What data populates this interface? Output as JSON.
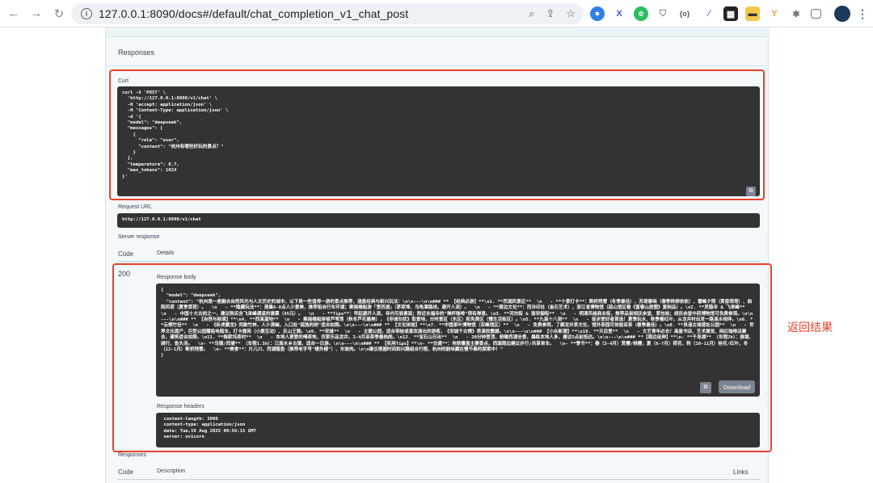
{
  "browser": {
    "url": "127.0.0.1:8090/docs#/default/chat_completion_v1_chat_post"
  },
  "responses_title": "Responses",
  "curl": {
    "label": "Curl",
    "code": "curl -X 'POST' \\\n  'http://127.0.0.1:8090/v1/chat' \\\n  -H 'accept: application/json' \\\n  -H 'Content-Type: application/json' \\\n  -d '{\n  \"model\": \"deepseek\",\n  \"messages\": [\n    {\n      \"role\": \"user\",\n      \"content\": \"杭州有哪些好玩的景点？\"\n    }\n  ],\n  \"temperature\": 0.7,\n  \"max_tokens\": 1024\n}'"
  },
  "request_url": {
    "label": "Request URL",
    "value": "http://127.0.0.1:8090/v1/chat"
  },
  "server_response": {
    "label": "Server response",
    "col_code": "Code",
    "col_details": "Details",
    "status_code": "200",
    "body_label": "Response body",
    "body": "{\n  \"model\": \"deepseek\",\n  \"content\": \"杭州是一座融合自然风光与人文历史的城市，以下是一些值得一游的景点推荐，涵盖经典与新兴玩法：\\n\\n---\\n\\n### ** 【经典必游】**\\n1. **西湖风景区**  \\n   - **十景打卡**：断桥残雪（冬季最佳）、苏堤春晓（春季杨柳依依）、雷峰夕照（黄昏观塔）、曲院风荷（夏季赏荷）。  \\n   - **隐藏玩法**：清晨6-8点人少景美，推荐租自行车环湖；乘摇橹船游「里西湖」（茅家埠、乌龟潭路线，避开人流）。  \\n   - **周边文化**：西泠印社（金石艺术）、浙江省博物馆（孤山馆区看《富春山居图》复制品）。\\n2. **灵隐寺 & 飞来峰**  \\n   - 中国十大古刹之一，建议购买含飞来峰通道的套票（45元）。  \\n   - **Tips**：早起避开人流，寺内可尝素面；附近永福寺的\"禅杯咖啡\"很有禅意。\\n3. **河坊街 & 南宋御街**  \\n   - 明清风格商业街，推荐品尝胡庆余堂、葱包桧；胡庆余堂中药博物馆可免费参观。\\n\\n---\\n\\n### ** 【自然与秘境】**\\n4. **西溪湿地**  \\n   - 乘摇橹船穿梭芦苇荡（秋冬芦花最美），《非诚勿扰》取景地，分时景区（东区）和免费区（慢生活街区）。\\n5. **九溪十八涧**  \\n   - 徒步爱好者首选！夏季玩水、秋季看红叶，从龙井村出发一路溪水相伴。\\n6. **云栖竹径**  \\n   - 《卧虎藏龙》同款竹林，人少清幽，入口处\"孤独的树\"适合拍照。\\n\\n---\\n\\n### ** 【文化体验】**\\n7. **中国茶叶博物馆（双峰馆区）**  \\n   - 免费参观，了解龙井茶文化，馆外茶园可体验采茶（春季最佳）。\\n8. **良渚古城遗址公园**  \\n   - 世界文化遗产，巨型公园需租电瓶车，打卡鹿苑（小鹿互动）、反山王陵。\\n9. **宋城**  \\n   - 主题公园，适合带娃或喜欢演出的游客，《宋城千古情》表演较震撼。\\n\\n---\\n\\n### 【小众新潮】**\\n10. **天目里**  \\n   - 文艺青年必去！高星书店、艺术展览、网红咖啡店聚合，建筑适合拍照。\\n11. **梅家坞茶村**  \\n   - 本地人更爱的喝茶地，农家乐品龙井，3-4月采茶季最热闹。\\n12. **宝石山日出**  \\n   - 30分钟登顶，俯瞰西湖全景，晨练本地人多，建议5点前抵达。\\n\\n---\\n\\n### **【周边延伸】**\\n- **千岛湖** （车程2h）：游湖、骑行、鱼头汤。  \\n- **乌镇/西塘** （车程1.5h）：江南水乡古镇，适合一日游。\\n\\n---\\n\\n### ** 【实用Tips】**\\n- **交通**：地铁覆盖主要景点，西湖周边建议步行/共享单车。  \\n- **季节**：春（3-4月）赏樱/桃樱，夏（6-7月）荷花，秋（10-11月）桂花/红叶，冬（12-1月）断桥残雪。  \\n- **美食**：片儿川、西湖醋鱼（推荐老字号\"楼外楼\"）、东坡肉。\\n\\n建议根据时间和兴趣组合行程，杭州的韵味藏在慢节奏的探索中！\"\n}",
    "download_label": "Download",
    "headers_label": "Response headers",
    "headers": " content-length: 3000\n content-type: application/json\n date: Tue,19 Aug 2025 09:56:15 GMT\n server: uvicorn"
  },
  "responses_footer": {
    "title": "Responses",
    "col_code": "Code",
    "col_description": "Description",
    "col_links": "Links"
  },
  "annotation": "返回结果",
  "colors": {
    "highlight": "#e8412b",
    "code_bg": "#333333"
  }
}
